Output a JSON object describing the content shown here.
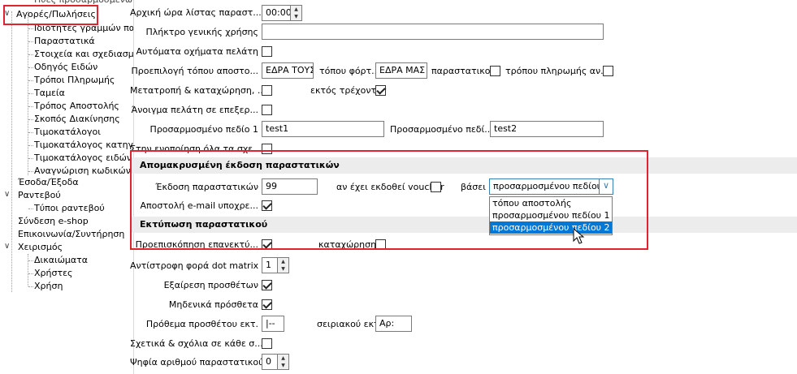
{
  "tree": {
    "top_partial": "Πύες προσαρμοσμένων τ",
    "root": "Αγορές/Πωλήσεις",
    "children": [
      "Ιδιότητες γραμμών παρασ",
      "Παραστατικά",
      "Στοιχεία και σχεδιασμός π",
      "Οδηγός Ειδών",
      "Τρόποι Πληρωμής",
      "Ταμεία",
      "Τρόπος Αποστολής",
      "Σκοπός Διακίνησης",
      "Τιμοκατάλογοι",
      "Τιμοκατάλογος κατηγοριώ",
      "Τιμοκατάλογος ειδών",
      "Αναγνώριση κωδικών"
    ],
    "esoda": "Έσοδα/Έξοδα",
    "rantevou": "Ραντεβού",
    "rantevou_children": [
      "Τύποι ραντεβού"
    ],
    "eshop": "Σύνδεση e-shop",
    "epikoinonia": "Επικοινωνία/Συντήρηση",
    "xeirismos": "Χειρισμός",
    "xeirismos_children": [
      "Δικαιώματα",
      "Χρήστες",
      "Χρήση"
    ]
  },
  "form": {
    "start_time_label": "Αρχική ώρα λίστας παραστ...",
    "start_time_value": "00:00",
    "general_key_label": "Πλήκτρο γενικής χρήσης",
    "general_key_value": "",
    "auto_customer_label": "Αυτόματα οχήματα πελάτη",
    "default_place_label": "Προεπιλογή τόπου αποστο...",
    "default_place_value": "ΕΔΡΑ ΤΟΥΣ",
    "place_load_label": "τόπου φόρτ...",
    "place_load_value": "ΕΔΡΑ ΜΑΣ",
    "doc_label": "παραστατικού",
    "payment_label": "τρόπου πληρωμής αν...",
    "convert_label": "Μετατροπή & καταχώρηση, ...",
    "except_current_label": "εκτός τρέχοντος",
    "open_customer_label": "Άνοιγμα πελάτη σε επεξερ...",
    "custom1_label": "Προσαρμοσμένο πεδίο 1",
    "custom1_value": "test1",
    "custom2_label": "Προσαρμοσμένο πεδί...",
    "custom2_value": "test2",
    "in_unify_label": "Στην ενοποίηση όλα τα σχε...",
    "remote_section": "Απομακρυσμένη έκδοση παραστατικών",
    "issue_docs_label": "Έκδοση παραστατικών",
    "issue_docs_value": "99",
    "voucher_label": "αν έχει εκδοθεί voucher",
    "basis_label": "βάσει",
    "basis_value": "προσαρμοσμένου πεδίου :",
    "dropdown_options": [
      "τόπου αποστολής",
      "προσαρμοσμένου πεδίου 1",
      "προσαρμοσμένου πεδίου 2"
    ],
    "send_email_label": "Αποστολή e-mail υποχρε...",
    "print_section": "Εκτύπωση παραστατικού",
    "preview_label": "Προεπισκόπηση επανεκτύ...",
    "registration_label": "καταχώρησης",
    "dot_matrix_label": "Αντίστροφη φορά dot matrix",
    "dot_matrix_value": "1",
    "exclude_addons_label": "Εξαίρεση προσθέτων",
    "zero_addons_label": "Μηδενικά πρόσθετα",
    "addon_prefix_label": "Πρόθεμα προσθέτου εκτ.",
    "addon_prefix_value": "|--",
    "serial_label": "σειριακού εκτ.",
    "serial_value": "Αρ:",
    "comments_label": "Σχετικά & σχόλια σε κάθε σ...",
    "digits_label": "Ψηφία αριθμού παραστατικού",
    "digits_value": "0"
  },
  "colors": {
    "highlight_box": "#e0232e",
    "selection": "#0078d7"
  }
}
